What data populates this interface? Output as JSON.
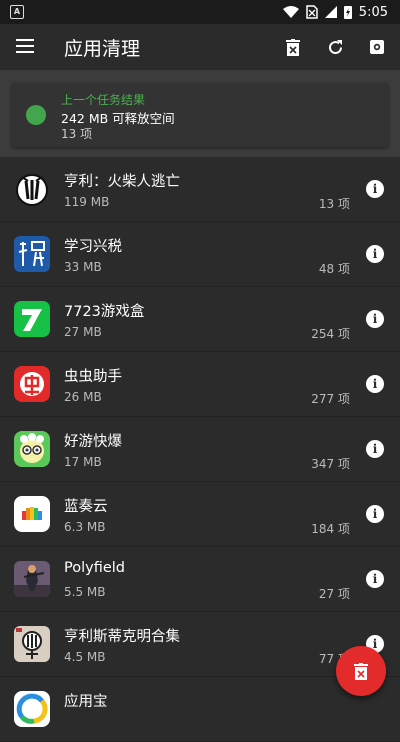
{
  "status_bar": {
    "time": "5:05",
    "app_glyph": "A"
  },
  "app_bar": {
    "title": "应用清理"
  },
  "result": {
    "label": "上一个任务结果",
    "size_text": "242 MB 可释放空间",
    "count_text": "13 项",
    "status_color": "#43a64e"
  },
  "apps": [
    {
      "name": "亨利：火柴人逃亡",
      "size": "119 MB",
      "count": "13 项",
      "icon": "stickman-icon"
    },
    {
      "name": "学习兴税",
      "size": "33 MB",
      "count": "48 项",
      "icon": "tax-icon"
    },
    {
      "name": "7723游戏盒",
      "size": "27 MB",
      "count": "254 项",
      "icon": "7723-icon"
    },
    {
      "name": "虫虫助手",
      "size": "26 MB",
      "count": "277 项",
      "icon": "chongchong-icon"
    },
    {
      "name": "好游快爆",
      "size": "17 MB",
      "count": "347 项",
      "icon": "haoyou-icon"
    },
    {
      "name": "蓝奏云",
      "size": "6.3 MB",
      "count": "184 项",
      "icon": "lanzou-icon"
    },
    {
      "name": "Polyfield",
      "size": "5.5 MB",
      "count": "27 项",
      "icon": "polyfield-icon"
    },
    {
      "name": "亨利斯蒂克明合集",
      "size": "4.5 MB",
      "count": "77 项",
      "icon": "henry-collection-icon"
    },
    {
      "name": "应用宝",
      "size": "",
      "count": "",
      "icon": "yingyongbao-icon"
    }
  ],
  "colors": {
    "background": "#2b2b2b",
    "accent_green": "#4caf50",
    "fab_red": "#e32b2b"
  }
}
